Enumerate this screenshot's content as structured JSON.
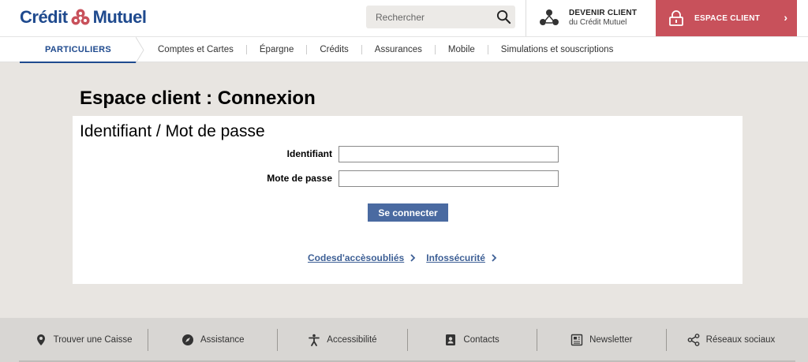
{
  "header": {
    "logo_left": "Crédit",
    "logo_right": "Mutuel",
    "search_placeholder": "Rechercher",
    "devenir_title": "DEVENIR CLIENT",
    "devenir_sub": "du Crédit Mutuel",
    "espace_label": "ESPACE CLIENT",
    "espace_arrow": "›"
  },
  "nav": {
    "active": "PARTICULIERS",
    "items": [
      "Comptes et Cartes",
      "Épargne",
      "Crédits",
      "Assurances",
      "Mobile",
      "Simulations et souscriptions"
    ]
  },
  "main": {
    "page_title": "Espace client : Connexion",
    "panel_title": "Identifiant / Mot de passe",
    "label_id": "Identifiant",
    "label_pw": "Mote de passe",
    "value_id": "",
    "value_pw": "",
    "submit": "Se connecter",
    "link_codes": "Codesd'accèsoubliés",
    "link_secu": "Infossécurité"
  },
  "footer": {
    "items": [
      "Trouver une Caisse",
      "Assistance",
      "Accessibilité",
      "Contacts",
      "Newsletter",
      "Réseaux sociaux"
    ]
  },
  "colors": {
    "brand_blue": "#1f4a8e",
    "espace_red": "#c8515b",
    "button_blue": "#4a6aa1",
    "background": "#e8e5e1"
  }
}
